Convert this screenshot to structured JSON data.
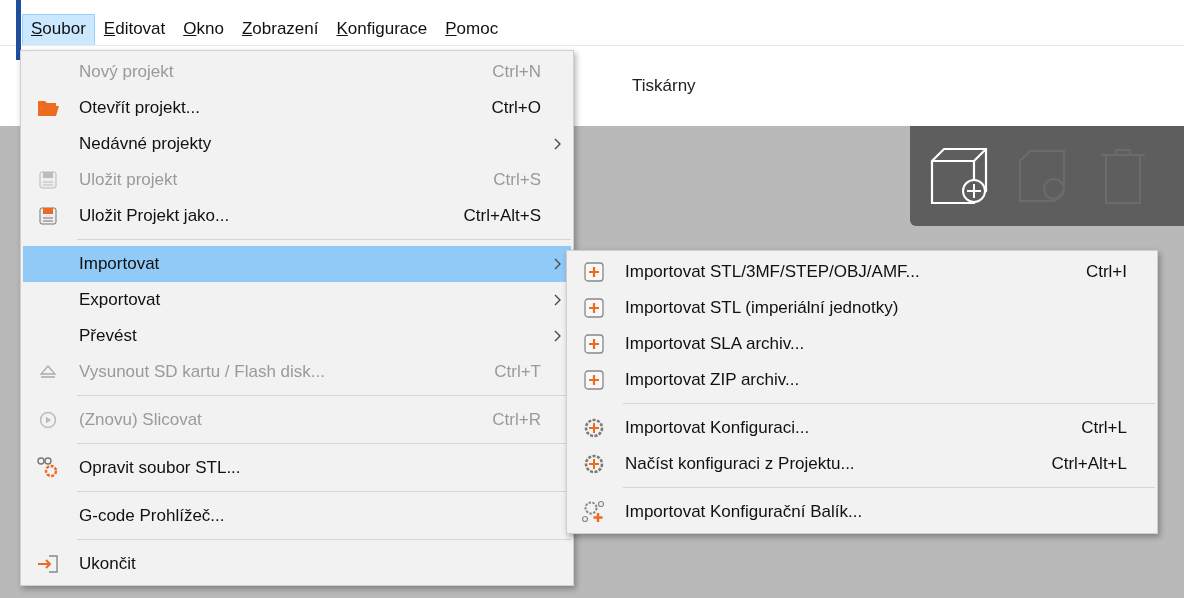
{
  "menubar": [
    {
      "label": "Soubor",
      "selected": true,
      "underline_first": true
    },
    {
      "label": "Editovat",
      "selected": false,
      "underline_first": true
    },
    {
      "label": "Okno",
      "selected": false,
      "underline_first": true
    },
    {
      "label": "Zobrazení",
      "selected": false,
      "underline_first": true
    },
    {
      "label": "Konfigurace",
      "selected": false,
      "underline_first": true
    },
    {
      "label": "Pomoc",
      "selected": false,
      "underline_first": true
    }
  ],
  "background": {
    "tab": "Tiskárny"
  },
  "menu": [
    {
      "kind": "item",
      "label": "Nový projekt",
      "shortcut": "Ctrl+N",
      "disabled": true,
      "selected": false,
      "submenu": false
    },
    {
      "kind": "item",
      "label": "Otevřít projekt...",
      "shortcut": "Ctrl+O",
      "disabled": false,
      "selected": false,
      "submenu": false
    },
    {
      "kind": "item",
      "label": "Nedávné projekty",
      "disabled": false,
      "selected": false,
      "submenu": true
    },
    {
      "kind": "item",
      "label": "Uložit projekt",
      "shortcut": "Ctrl+S",
      "disabled": true,
      "selected": false,
      "submenu": false
    },
    {
      "kind": "item",
      "label": "Uložit Projekt jako...",
      "shortcut": "Ctrl+Alt+S",
      "disabled": false,
      "selected": false,
      "submenu": false
    },
    {
      "kind": "separator"
    },
    {
      "kind": "item",
      "label": "Importovat",
      "disabled": false,
      "selected": true,
      "submenu": true
    },
    {
      "kind": "item",
      "label": "Exportovat",
      "disabled": false,
      "selected": false,
      "submenu": true
    },
    {
      "kind": "item",
      "label": "Převést",
      "disabled": false,
      "selected": false,
      "submenu": true
    },
    {
      "kind": "item",
      "label": "Vysunout SD kartu / Flash disk...",
      "shortcut": "Ctrl+T",
      "disabled": true,
      "selected": false,
      "submenu": false
    },
    {
      "kind": "separator"
    },
    {
      "kind": "item",
      "label": "(Znovu) Slicovat",
      "shortcut": "Ctrl+R",
      "disabled": true,
      "selected": false,
      "submenu": false
    },
    {
      "kind": "separator"
    },
    {
      "kind": "item",
      "label": "Opravit soubor STL...",
      "disabled": false,
      "selected": false,
      "submenu": false
    },
    {
      "kind": "separator"
    },
    {
      "kind": "item",
      "label": "G-code Prohlížeč...",
      "disabled": false,
      "selected": false,
      "submenu": false
    },
    {
      "kind": "separator"
    },
    {
      "kind": "item",
      "label": "Ukončit",
      "disabled": false,
      "selected": false,
      "submenu": false
    }
  ],
  "submenu": [
    {
      "kind": "item",
      "label": "Importovat STL/3MF/STEP/OBJ/AMF...",
      "shortcut": "Ctrl+I",
      "disabled": false,
      "selected": false,
      "submenu": false
    },
    {
      "kind": "item",
      "label": "Importovat STL (imperiální jednotky)",
      "disabled": false,
      "selected": false,
      "submenu": false
    },
    {
      "kind": "item",
      "label": "Importovat SLA archiv...",
      "disabled": false,
      "selected": false,
      "submenu": false
    },
    {
      "kind": "item",
      "label": "Importovat ZIP archiv...",
      "disabled": false,
      "selected": false,
      "submenu": false
    },
    {
      "kind": "separator"
    },
    {
      "kind": "item",
      "label": "Importovat Konfiguraci...",
      "shortcut": "Ctrl+L",
      "disabled": false,
      "selected": false,
      "submenu": false
    },
    {
      "kind": "item",
      "label": "Načíst konfiguraci z Projektu...",
      "shortcut": "Ctrl+Alt+L",
      "disabled": false,
      "selected": false,
      "submenu": false
    },
    {
      "kind": "separator"
    },
    {
      "kind": "item",
      "label": "Importovat Konfigurační Balík...",
      "disabled": false,
      "selected": false,
      "submenu": false
    }
  ]
}
